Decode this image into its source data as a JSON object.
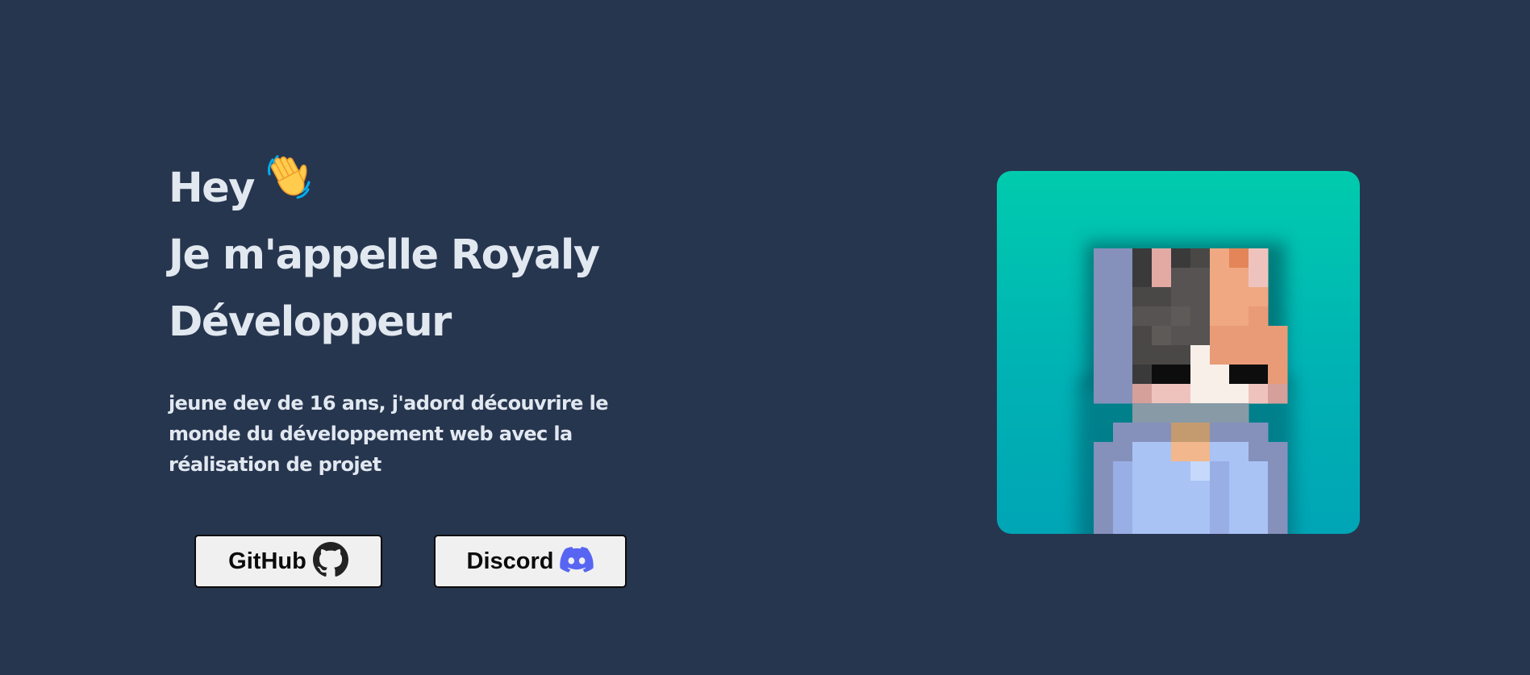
{
  "hero": {
    "greeting": "Hey",
    "greeting_icon": "waving-hand-icon",
    "name_line": "Je m'appelle Royaly",
    "role_line": "Développeur",
    "description": "jeune dev de 16 ans, j'adord découvrire le monde du développement web avec la réalisation de projet"
  },
  "buttons": {
    "github_label": "GitHub",
    "github_icon": "github-icon",
    "discord_label": "Discord",
    "discord_icon": "discord-icon"
  },
  "avatar": {
    "icon": "pixel-avatar-image"
  },
  "colors": {
    "background": "#27364f",
    "text": "#e2e8f0",
    "button_background": "#f0f0f0",
    "discord_brand": "#5865f2",
    "avatar_gradient_top": "#00cbae",
    "avatar_gradient_bottom": "#00a5b5"
  }
}
